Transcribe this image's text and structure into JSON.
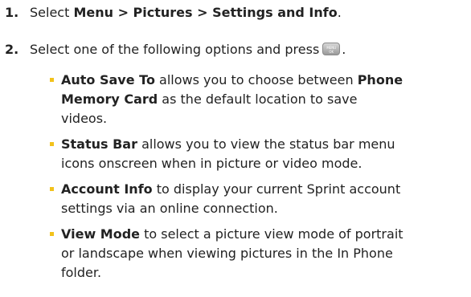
{
  "steps": [
    {
      "number": "1.",
      "prefix": "Select ",
      "path": "Menu > Pictures > Settings and Info",
      "suffix": "."
    },
    {
      "number": "2.",
      "text": "Select one of the following options and press",
      "key_top": "MENU",
      "key_bottom": "OK",
      "suffix": "."
    }
  ],
  "options": [
    {
      "term": "Auto Save To",
      "line1_text": " allows you to choose between ",
      "line1_b": "Phone",
      "line2_b": "Memory Card",
      "line2_text": " as the default location to save",
      "line3": "videos."
    },
    {
      "term": "Status Bar",
      "line1_text": " allows you to view the status bar menu",
      "line2": "icons onscreen when in picture or video mode."
    },
    {
      "term": "Account Info",
      "line1_text": " to display your current Sprint account",
      "line2": "settings via an online connection."
    },
    {
      "term": "View Mode",
      "line1_text": " to select a picture view mode of portrait",
      "line2": "or landscape when viewing pictures in the In Phone",
      "line3": "folder."
    }
  ],
  "colors": {
    "bullet": "#f2c21b",
    "text": "#222222",
    "key": "#9a9a9a"
  },
  "icons": {
    "key": "menu-ok-key-icon"
  }
}
